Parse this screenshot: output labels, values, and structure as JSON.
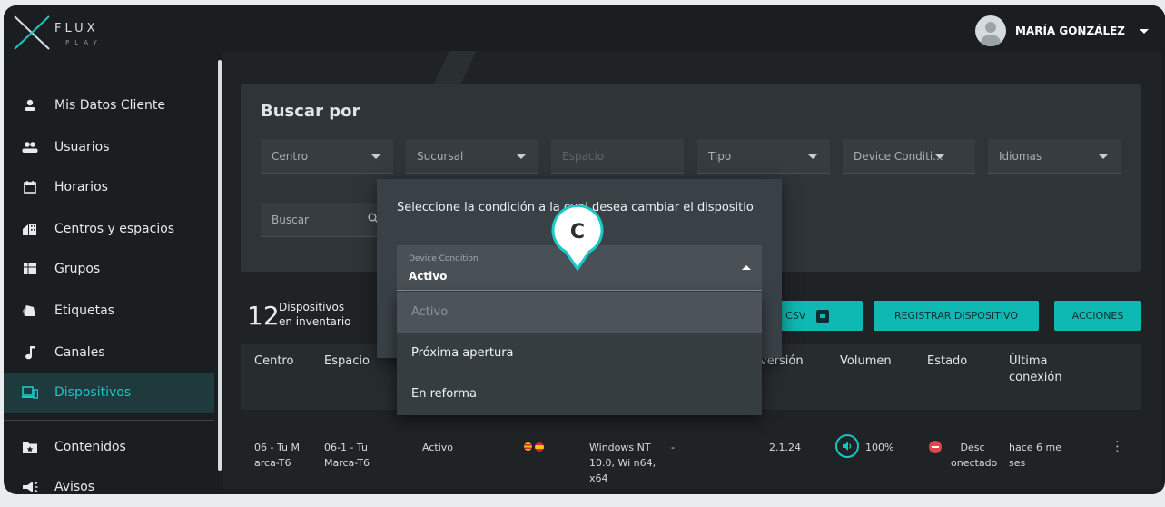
{
  "app": {
    "logo_text": "FLUX",
    "logo_sub": "PLAY"
  },
  "user": {
    "name": "MARÍA GONZÁLEZ"
  },
  "sidebar": {
    "items": [
      {
        "label": "Mis Datos Cliente",
        "icon": "person-icon"
      },
      {
        "label": "Usuarios",
        "icon": "group-icon"
      },
      {
        "label": "Horarios",
        "icon": "calendar-icon"
      },
      {
        "label": "Centros y espacios",
        "icon": "building-icon"
      },
      {
        "label": "Grupos",
        "icon": "grid-icon"
      },
      {
        "label": "Etiquetas",
        "icon": "tag-icon"
      },
      {
        "label": "Canales",
        "icon": "music-note-icon"
      },
      {
        "label": "Dispositivos",
        "icon": "devices-icon",
        "active": true
      },
      {
        "label": "Contenidos",
        "icon": "folder-star-icon"
      },
      {
        "label": "Avisos",
        "icon": "megaphone-icon"
      }
    ]
  },
  "search": {
    "title": "Buscar por",
    "filters": [
      {
        "label": "Centro",
        "dropdown": true
      },
      {
        "label": "Sucursal",
        "dropdown": true
      },
      {
        "label": "Espacio",
        "dropdown": false,
        "placeholder": true
      },
      {
        "label": "Tipo",
        "dropdown": true
      },
      {
        "label": "Device Conditi...",
        "dropdown": true
      },
      {
        "label": "Idiomas",
        "dropdown": true
      }
    ],
    "query_placeholder": "Buscar"
  },
  "inventory": {
    "count": "12",
    "line1": "Dispositivos",
    "line2": "en inventario"
  },
  "buttons": {
    "csv": "R CSV",
    "register": "REGISTRAR DISPOSITIVO",
    "actions": "ACCIONES"
  },
  "table": {
    "headers": [
      "Centro",
      "Espacio",
      "versión",
      "Volumen",
      "Estado",
      "Última conexión"
    ],
    "row": {
      "centro": "06 - Tu M arca-T6",
      "espacio": "06-1 - Tu Marca-T6",
      "condicion": "Activo",
      "so": "Windows NT 10.0, Wi n64, x64",
      "dash": "-",
      "version": "2.1.24",
      "volumen": "100%",
      "estado": "Desc onectado",
      "ultima": "hace 6 me ses"
    }
  },
  "modal": {
    "text": "Seleccione la condición a la cual desea cambiar el dispositio",
    "select_label": "Device Condition",
    "select_value": "Activo",
    "options": [
      "Activo",
      "Próxima apertura",
      "En reforma"
    ]
  },
  "pin": {
    "letter": "C"
  },
  "colors": {
    "accent": "#0fb9b3",
    "danger": "#e0464d",
    "bg": "#1b1e20"
  }
}
